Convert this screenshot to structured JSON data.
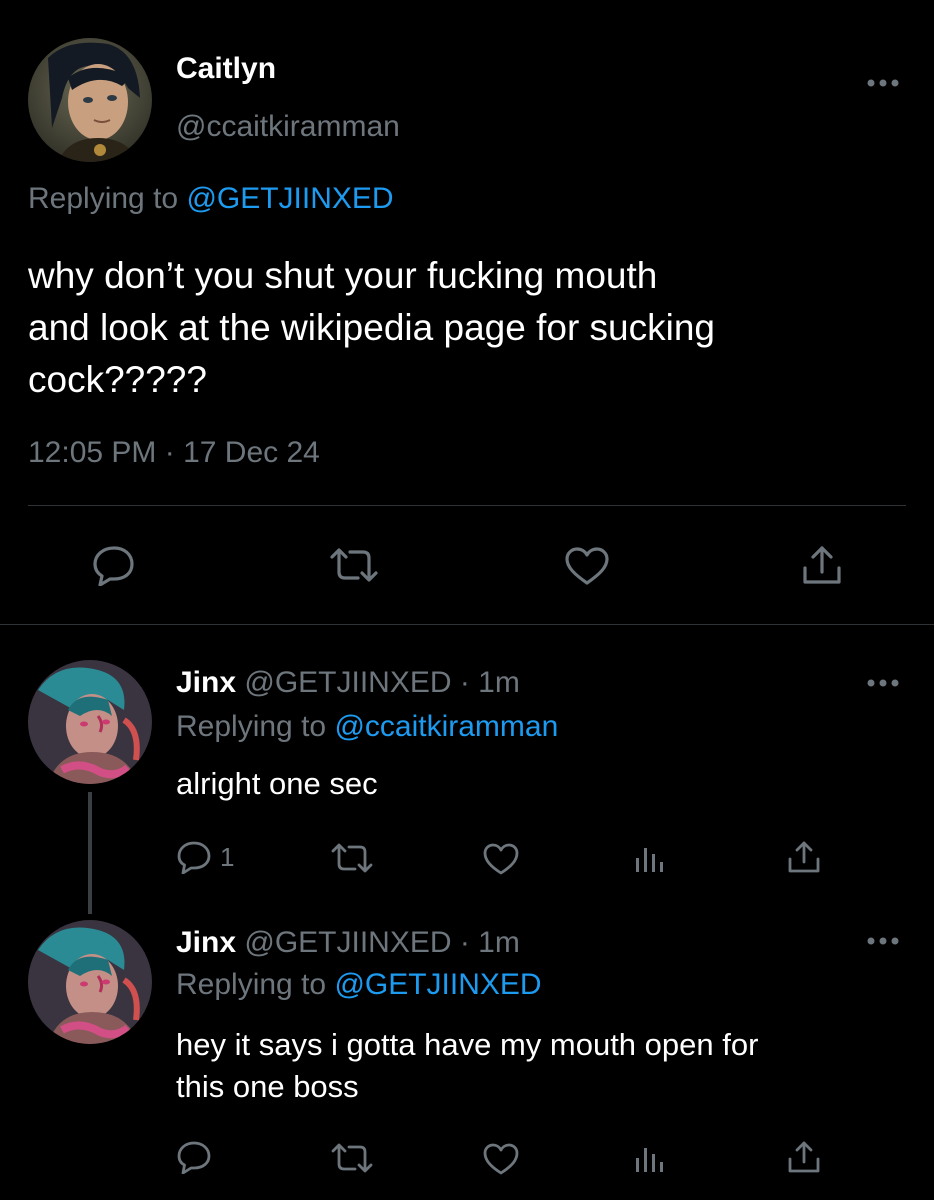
{
  "main_tweet": {
    "display_name": "Caitlyn",
    "handle": "@ccaitkiramman",
    "replying_prefix": "Replying to",
    "replying_handle": "@GETJIINXED",
    "text_line1": "why don’t you shut your fucking mouth",
    "text_line2": "and look at the wikipedia page for sucking",
    "text_line3": "cock?????",
    "timestamp": "12:05 PM · 17 Dec 24",
    "icons": [
      "reply-icon",
      "retweet-icon",
      "like-icon",
      "share-icon",
      "more-icon"
    ]
  },
  "replies": [
    {
      "display_name": "Jinx",
      "meta": "@GETJIINXED · 1m",
      "replying_prefix": "Replying to",
      "replying_handle": "@ccaitkiramman",
      "text_line1": "alright one sec",
      "reply_count": "1"
    },
    {
      "display_name": "Jinx",
      "meta": "@GETJIINXED · 1m",
      "replying_prefix": "Replying to",
      "replying_handle": "@GETJIINXED",
      "text_line1": "hey it says i gotta have my mouth open for",
      "text_line2": "this one boss"
    }
  ],
  "colors": {
    "background": "#000000",
    "text": "#ffffff",
    "secondary": "#6e767d",
    "link": "#1d9bf0",
    "divider": "#2f3336"
  }
}
